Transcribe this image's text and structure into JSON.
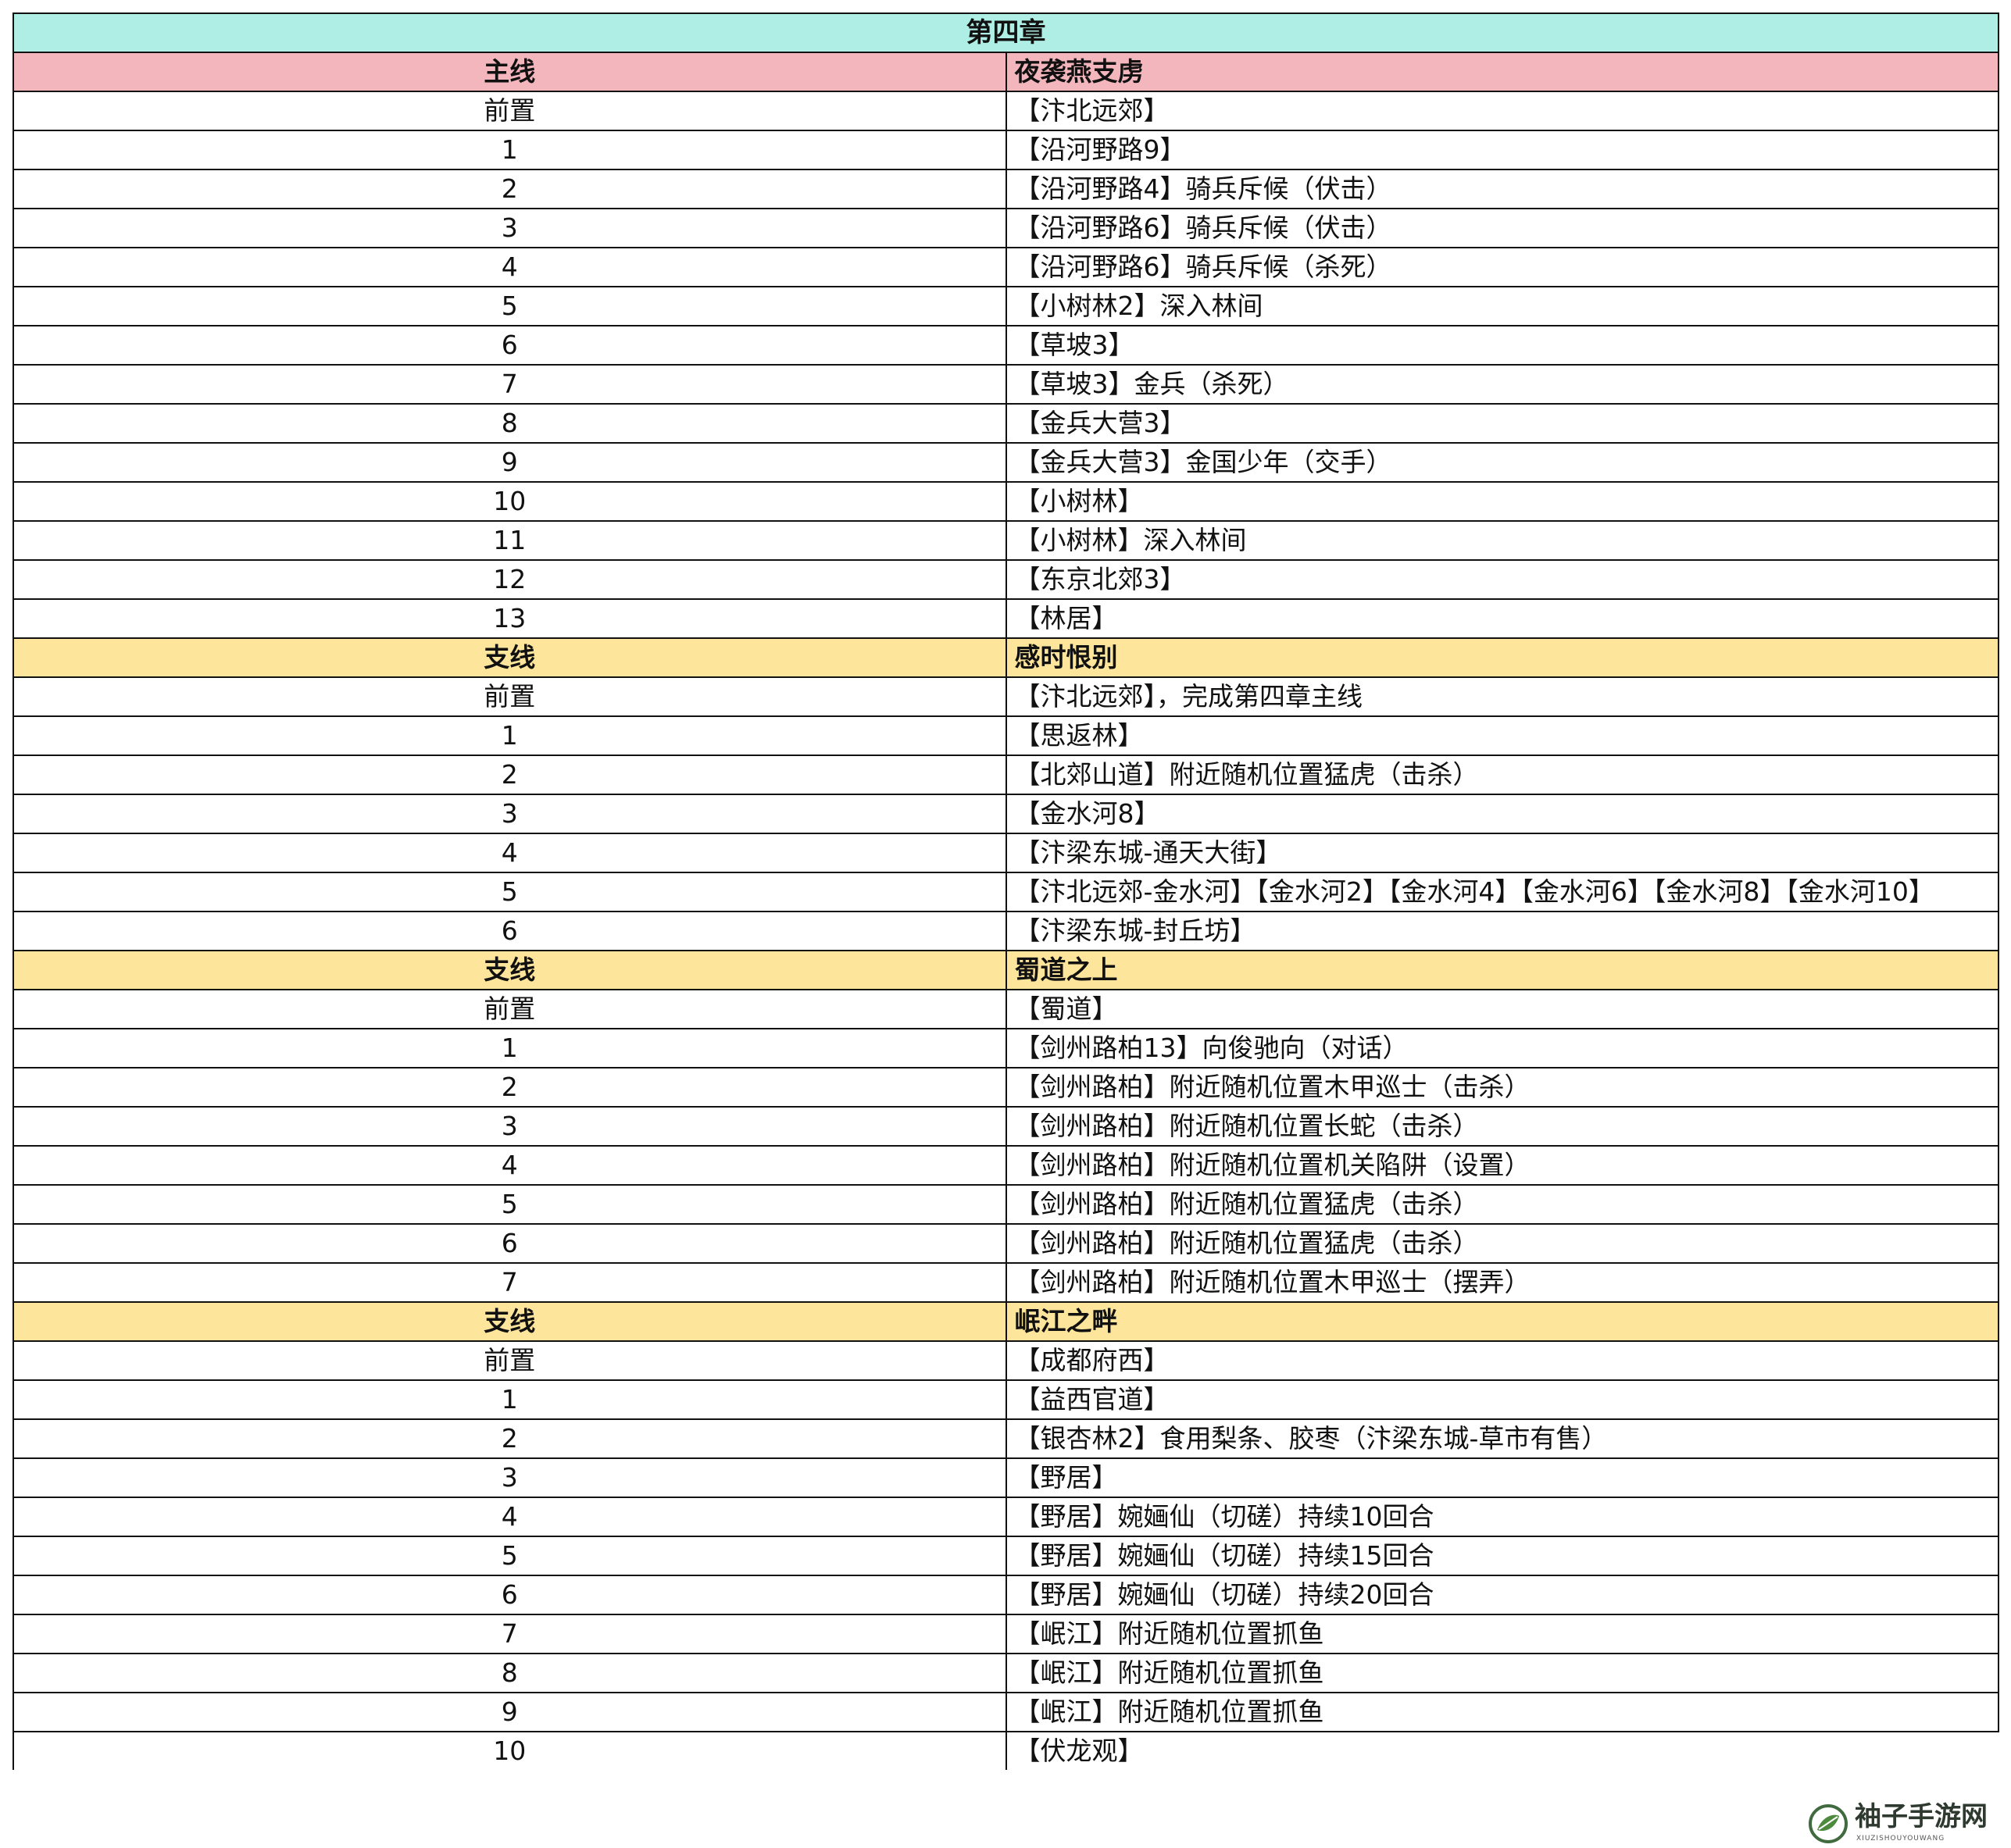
{
  "title": "第四章",
  "sections": [
    {
      "kind": "main",
      "tag": "主线",
      "name": "夜袭燕支虏",
      "rows": [
        [
          "前置",
          "【汴北远郊】"
        ],
        [
          "1",
          "【沿河野路9】"
        ],
        [
          "2",
          "【沿河野路4】骑兵斥候（伏击）"
        ],
        [
          "3",
          "【沿河野路6】骑兵斥候（伏击）"
        ],
        [
          "4",
          "【沿河野路6】骑兵斥候（杀死）"
        ],
        [
          "5",
          "【小树林2】深入林间"
        ],
        [
          "6",
          "【草坡3】"
        ],
        [
          "7",
          "【草坡3】金兵（杀死）"
        ],
        [
          "8",
          "【金兵大营3】"
        ],
        [
          "9",
          "【金兵大营3】金国少年（交手）"
        ],
        [
          "10",
          "【小树林】"
        ],
        [
          "11",
          "【小树林】深入林间"
        ],
        [
          "12",
          "【东京北郊3】"
        ],
        [
          "13",
          "【林居】"
        ]
      ]
    },
    {
      "kind": "side",
      "tag": "支线",
      "name": "感时恨别",
      "rows": [
        [
          "前置",
          "【汴北远郊】，完成第四章主线"
        ],
        [
          "1",
          "【思返林】"
        ],
        [
          "2",
          "【北郊山道】附近随机位置猛虎（击杀）"
        ],
        [
          "3",
          "【金水河8】"
        ],
        [
          "4",
          "【汴梁东城-通天大街】"
        ],
        [
          "5",
          "【汴北远郊-金水河】【金水河2】【金水河4】【金水河6】【金水河8】【金水河10】"
        ],
        [
          "6",
          "【汴梁东城-封丘坊】"
        ]
      ]
    },
    {
      "kind": "side",
      "tag": "支线",
      "name": "蜀道之上",
      "rows": [
        [
          "前置",
          "【蜀道】"
        ],
        [
          "1",
          "【剑州路柏13】向俊驰向（对话）"
        ],
        [
          "2",
          "【剑州路柏】附近随机位置木甲巡士（击杀）"
        ],
        [
          "3",
          "【剑州路柏】附近随机位置长蛇（击杀）"
        ],
        [
          "4",
          "【剑州路柏】附近随机位置机关陷阱（设置）"
        ],
        [
          "5",
          "【剑州路柏】附近随机位置猛虎（击杀）"
        ],
        [
          "6",
          "【剑州路柏】附近随机位置猛虎（击杀）"
        ],
        [
          "7",
          "【剑州路柏】附近随机位置木甲巡士（摆弄）"
        ]
      ]
    },
    {
      "kind": "side",
      "tag": "支线",
      "name": "岷江之畔",
      "rows": [
        [
          "前置",
          "【成都府西】"
        ],
        [
          "1",
          "【益西官道】"
        ],
        [
          "2",
          "【银杏林2】食用梨条、胶枣（汴梁东城-草市有售）"
        ],
        [
          "3",
          "【野居】"
        ],
        [
          "4",
          "【野居】婉婳仙（切磋）持续10回合"
        ],
        [
          "5",
          "【野居】婉婳仙（切磋）持续15回合"
        ],
        [
          "6",
          "【野居】婉婳仙（切磋）持续20回合"
        ],
        [
          "7",
          "【岷江】附近随机位置抓鱼"
        ],
        [
          "8",
          "【岷江】附近随机位置抓鱼"
        ],
        [
          "9",
          "【岷江】附近随机位置抓鱼"
        ],
        [
          "10",
          "【伏龙观】"
        ]
      ]
    }
  ],
  "watermark": {
    "name": "袖子手游网",
    "sub": "XIUZISHOUYOUWANG",
    "icon": "leaf-logo-icon"
  }
}
